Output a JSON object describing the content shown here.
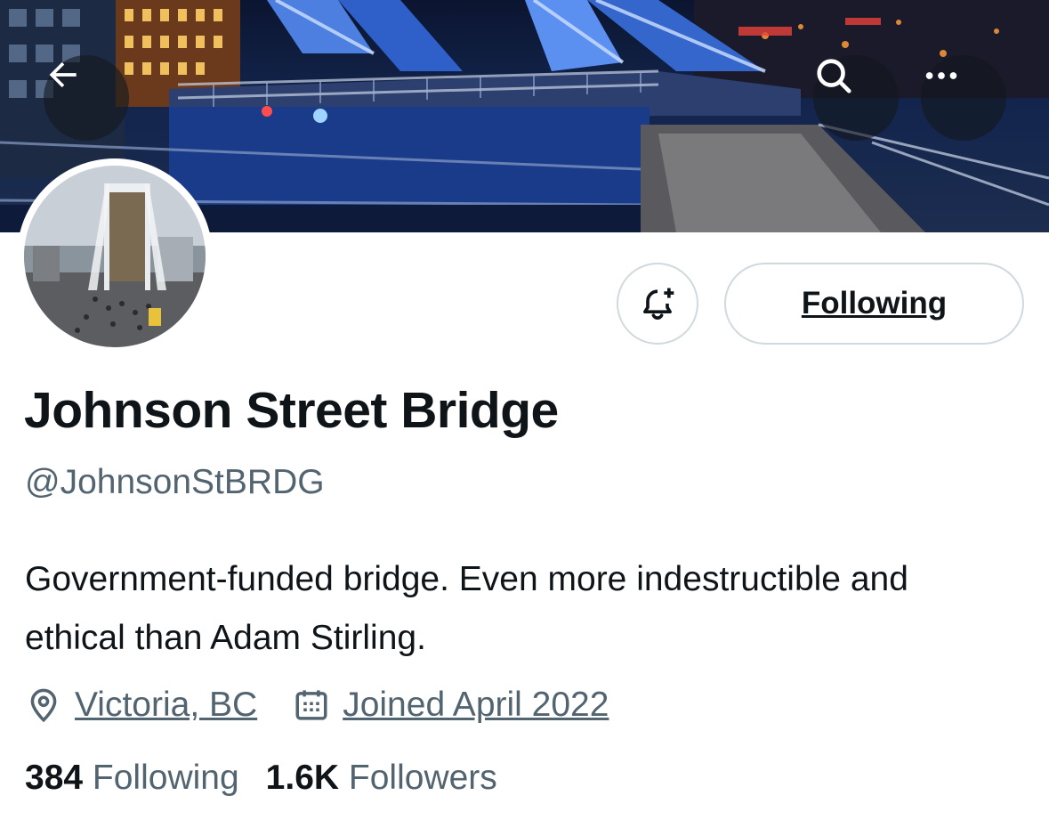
{
  "header": {
    "back_icon": "arrow-left-icon",
    "search_icon": "search-icon",
    "more_icon": "more-horizontal-icon"
  },
  "actions": {
    "notify_icon": "bell-plus-icon",
    "following_label": "Following"
  },
  "profile": {
    "display_name": "Johnson Street Bridge",
    "handle": "@JohnsonStBRDG",
    "bio": "Government-funded bridge. Even more indestructible and ethical than Adam Stirling.",
    "location": "Victoria, BC",
    "joined": "Joined April 2022"
  },
  "stats": {
    "following_count": "384",
    "following_label": "Following",
    "followers_count": "1.6K",
    "followers_label": "Followers"
  },
  "colors": {
    "primary_text": "#0f1419",
    "secondary_text": "#536471",
    "border": "#cfd9de"
  }
}
